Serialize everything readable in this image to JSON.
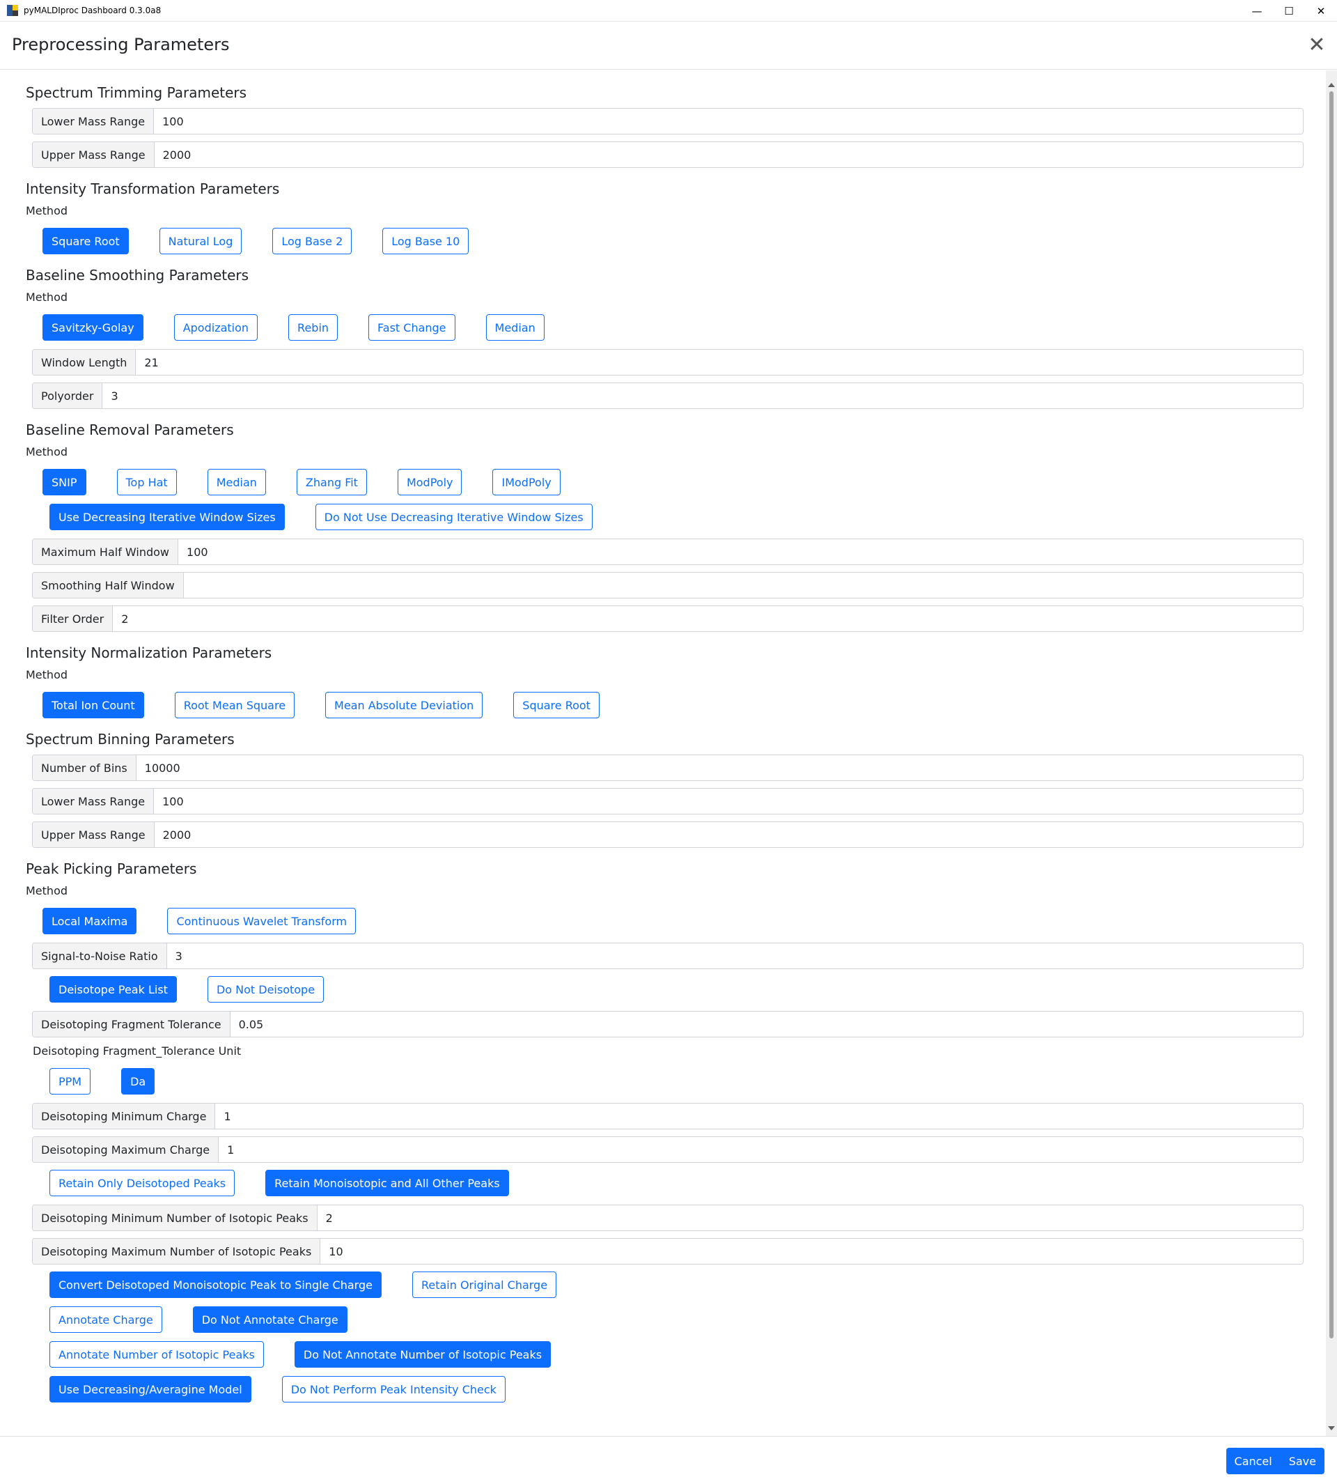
{
  "window": {
    "title": "pyMALDIproc Dashboard 0.3.0a8",
    "minimize_glyph": "—",
    "maximize_glyph": "☐",
    "close_glyph": "✕"
  },
  "modal": {
    "title": "Preprocessing Parameters",
    "close_glyph": "✕"
  },
  "method_label": "Method",
  "trimming": {
    "title": "Spectrum Trimming Parameters",
    "lower_label": "Lower Mass Range",
    "lower_value": "100",
    "upper_label": "Upper Mass Range",
    "upper_value": "2000"
  },
  "intensity_transform": {
    "title": "Intensity Transformation Parameters",
    "methods": [
      "Square Root",
      "Natural Log",
      "Log Base 2",
      "Log Base 10"
    ],
    "selected": 0
  },
  "smoothing": {
    "title": "Baseline Smoothing Parameters",
    "methods": [
      "Savitzky-Golay",
      "Apodization",
      "Rebin",
      "Fast Change",
      "Median"
    ],
    "selected": 0,
    "window_label": "Window Length",
    "window_value": "21",
    "polyorder_label": "Polyorder",
    "polyorder_value": "3"
  },
  "removal": {
    "title": "Baseline Removal Parameters",
    "methods": [
      "SNIP",
      "Top Hat",
      "Median",
      "Zhang Fit",
      "ModPoly",
      "IModPoly"
    ],
    "selected": 0,
    "decreasing_on": "Use Decreasing Iterative Window Sizes",
    "decreasing_off": "Do Not Use Decreasing Iterative Window Sizes",
    "max_half_label": "Maximum Half Window",
    "max_half_value": "100",
    "smooth_half_label": "Smoothing Half Window",
    "smooth_half_value": "",
    "filter_order_label": "Filter Order",
    "filter_order_value": "2"
  },
  "normalization": {
    "title": "Intensity Normalization Parameters",
    "methods": [
      "Total Ion Count",
      "Root Mean Square",
      "Mean Absolute Deviation",
      "Square Root"
    ],
    "selected": 0
  },
  "binning": {
    "title": "Spectrum Binning Parameters",
    "bins_label": "Number of Bins",
    "bins_value": "10000",
    "lower_label": "Lower Mass Range",
    "lower_value": "100",
    "upper_label": "Upper Mass Range",
    "upper_value": "2000"
  },
  "peak_picking": {
    "title": "Peak Picking Parameters",
    "methods": [
      "Local Maxima",
      "Continuous Wavelet Transform"
    ],
    "selected": 0,
    "snr_label": "Signal-to-Noise Ratio",
    "snr_value": "3",
    "deisotope_on": "Deisotope Peak List",
    "deisotope_off": "Do Not Deisotope",
    "frag_tol_label": "Deisotoping Fragment Tolerance",
    "frag_tol_value": "0.05",
    "frag_tol_unit_label": "Deisotoping Fragment_Tolerance Unit",
    "unit_ppm": "PPM",
    "unit_da": "Da",
    "min_charge_label": "Deisotoping Minimum Charge",
    "min_charge_value": "1",
    "max_charge_label": "Deisotoping Maximum Charge",
    "max_charge_value": "1",
    "retain_only": "Retain Only Deisotoped Peaks",
    "retain_all": "Retain Monoisotopic and All Other Peaks",
    "min_iso_label": "Deisotoping Minimum Number of Isotopic Peaks",
    "min_iso_value": "2",
    "max_iso_label": "Deisotoping Maximum Number of Isotopic Peaks",
    "max_iso_value": "10",
    "convert_charge": "Convert Deisotoped Monoisotopic Peak to Single Charge",
    "retain_charge": "Retain Original Charge",
    "annotate_charge": "Annotate Charge",
    "no_annotate_charge": "Do Not Annotate Charge",
    "annotate_iso": "Annotate Number of Isotopic Peaks",
    "no_annotate_iso": "Do Not Annotate Number of Isotopic Peaks",
    "decreasing_model": "Use Decreasing/Averagine Model",
    "no_intensity_check": "Do Not Perform Peak Intensity Check"
  },
  "footer": {
    "cancel": "Cancel",
    "save": "Save"
  },
  "colors": {
    "primary": "#0d6efd",
    "label_bg": "#f3f3f3",
    "border": "#ced4da"
  }
}
